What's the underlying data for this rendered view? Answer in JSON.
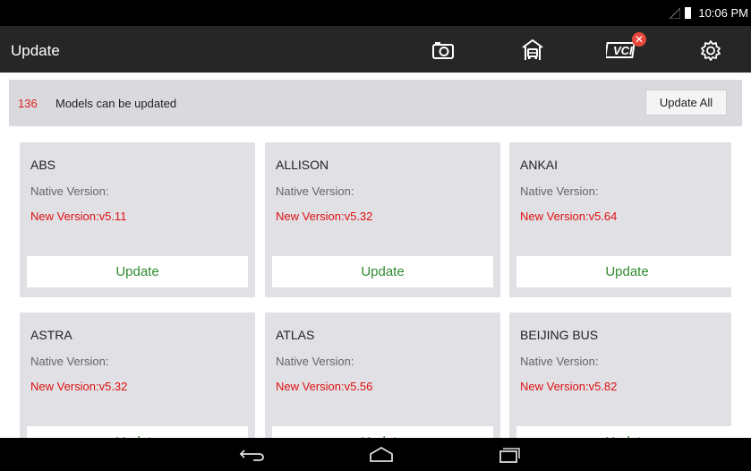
{
  "status_bar": {
    "time": "10:06 PM"
  },
  "app_bar": {
    "title": "Update",
    "icons": [
      "camera-icon",
      "garage-icon",
      "vci-icon",
      "settings-icon"
    ],
    "vci_label": "VCI",
    "vci_badge": "✕"
  },
  "info_bar": {
    "count": "136",
    "message": "Models can be updated",
    "update_all_label": "Update All"
  },
  "cards": [
    {
      "name": "ABS",
      "native_label": "Native Version:",
      "new_version": "New Version:v5.11",
      "button": "Update"
    },
    {
      "name": "ALLISON",
      "native_label": "Native Version:",
      "new_version": "New Version:v5.32",
      "button": "Update"
    },
    {
      "name": "ANKAI",
      "native_label": "Native Version:",
      "new_version": "New Version:v5.64",
      "button": "Update"
    },
    {
      "name": "ASTRA",
      "native_label": "Native Version:",
      "new_version": "New Version:v5.32",
      "button": "Update"
    },
    {
      "name": "ATLAS",
      "native_label": "Native Version:",
      "new_version": "New Version:v5.56",
      "button": "Update"
    },
    {
      "name": "BEIJING BUS",
      "native_label": "Native Version:",
      "new_version": "New Version:v5.82",
      "button": "Update"
    }
  ],
  "colors": {
    "accent_green": "#2e8b2e",
    "alert_red": "#e02020",
    "appbar_bg": "#262626"
  }
}
